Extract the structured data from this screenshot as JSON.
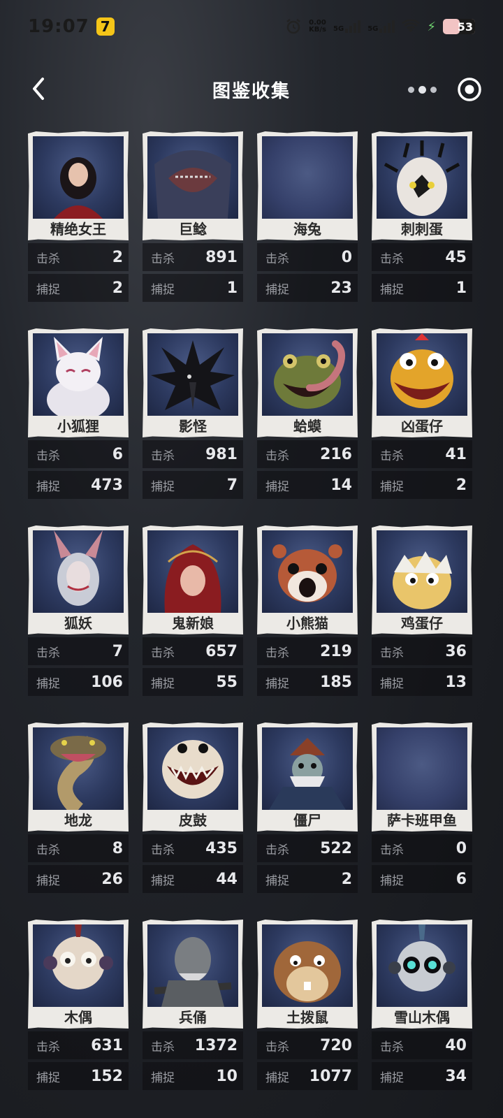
{
  "status_bar": {
    "time": "19:07",
    "app_badge": "7",
    "net_speed": "0.00",
    "net_unit": "KB/s",
    "signal_1": "5G",
    "signal_2": "5G",
    "battery": "53"
  },
  "header": {
    "title": "图鉴收集"
  },
  "stat_labels": {
    "kills": "击杀",
    "captures": "捕捉"
  },
  "monsters": [
    {
      "name": "精绝女王",
      "kills": "2",
      "captures": "2"
    },
    {
      "name": "巨鲶",
      "kills": "891",
      "captures": "1"
    },
    {
      "name": "海兔",
      "kills": "0",
      "captures": "23"
    },
    {
      "name": "刺刺蛋",
      "kills": "45",
      "captures": "1"
    },
    {
      "name": "小狐狸",
      "kills": "6",
      "captures": "473"
    },
    {
      "name": "影怪",
      "kills": "981",
      "captures": "7"
    },
    {
      "name": "蛤蟆",
      "kills": "216",
      "captures": "14"
    },
    {
      "name": "凶蛋仔",
      "kills": "41",
      "captures": "2"
    },
    {
      "name": "狐妖",
      "kills": "7",
      "captures": "106"
    },
    {
      "name": "鬼新娘",
      "kills": "657",
      "captures": "55"
    },
    {
      "name": "小熊猫",
      "kills": "219",
      "captures": "185"
    },
    {
      "name": "鸡蛋仔",
      "kills": "36",
      "captures": "13"
    },
    {
      "name": "地龙",
      "kills": "8",
      "captures": "26"
    },
    {
      "name": "皮鼓",
      "kills": "435",
      "captures": "44"
    },
    {
      "name": "僵尸",
      "kills": "522",
      "captures": "2"
    },
    {
      "name": "萨卡班甲鱼",
      "kills": "0",
      "captures": "6"
    },
    {
      "name": "木偶",
      "kills": "631",
      "captures": "152"
    },
    {
      "name": "兵俑",
      "kills": "1372",
      "captures": "10"
    },
    {
      "name": "土拨鼠",
      "kills": "720",
      "captures": "1077"
    },
    {
      "name": "雪山木偶",
      "kills": "40",
      "captures": "34"
    }
  ]
}
